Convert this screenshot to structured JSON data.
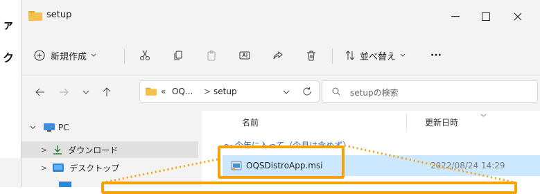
{
  "window": {
    "title": "setup"
  },
  "toolbar": {
    "new_label": "新規作成",
    "sort_label": "並べ替え",
    "more_label": "···"
  },
  "address": {
    "crumb_overflow": "«",
    "crumb_parent": "OQ...",
    "separator": ">",
    "crumb_current": "setup"
  },
  "search": {
    "placeholder": "setupの検索"
  },
  "nav_tree": {
    "items": [
      {
        "label": "PC"
      },
      {
        "label": "ダウンロード"
      },
      {
        "label": "デスクトップ"
      }
    ]
  },
  "file_list": {
    "columns": {
      "name": "名前",
      "date": "更新日時"
    },
    "group_header": "〜 今年に入って（今月は含めず）",
    "rows": [
      {
        "name": "OQSDistroApp.msi",
        "date": "2022/08/24 14:29"
      }
    ]
  },
  "colors": {
    "highlight": "#f5a20a",
    "selection": "#cce8ff",
    "folder": "#f2c24a"
  }
}
